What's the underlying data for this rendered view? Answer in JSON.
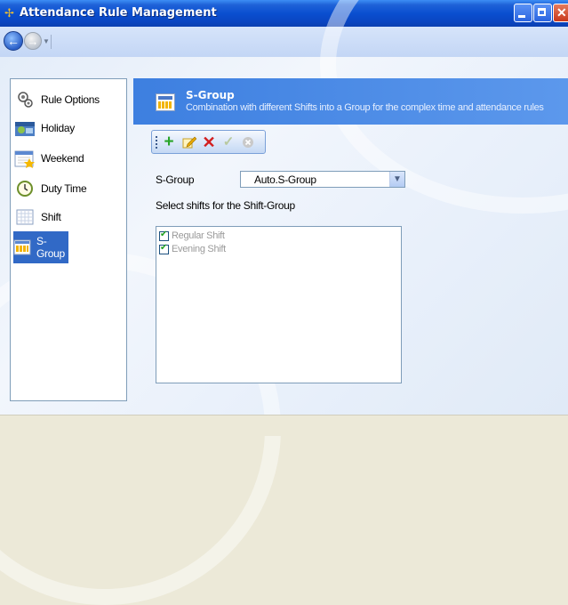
{
  "window": {
    "title": "Attendance Rule Management"
  },
  "sidebar": {
    "items": [
      {
        "label": "Rule Options",
        "icon": "rule-options-icon"
      },
      {
        "label": "Holiday",
        "icon": "holiday-icon"
      },
      {
        "label": "Weekend",
        "icon": "weekend-icon"
      },
      {
        "label": "Duty Time",
        "icon": "clock-icon"
      },
      {
        "label": "Shift",
        "icon": "shift-icon"
      },
      {
        "label": "S-Group",
        "icon": "s-group-icon",
        "selected": true
      }
    ]
  },
  "header": {
    "title": "S-Group",
    "subtitle": "Combination with different Shifts into a Group for the complex time and attendance rules"
  },
  "toolbar": {
    "buttons": [
      "add-icon",
      "edit-icon",
      "delete-icon",
      "confirm-icon",
      "cancel-icon"
    ]
  },
  "form": {
    "sgroup_label": "S-Group",
    "sgroup_value": "Auto.S-Group",
    "select_shifts_label": "Select shifts for the Shift-Group",
    "shifts": [
      {
        "label": "Regular Shift",
        "checked": true
      },
      {
        "label": "Evening Shift",
        "checked": true
      }
    ]
  },
  "colors": {
    "title_bar": "#0a4fd0",
    "header_bg": "#3d7fe0",
    "selected_item": "#3169c6"
  }
}
